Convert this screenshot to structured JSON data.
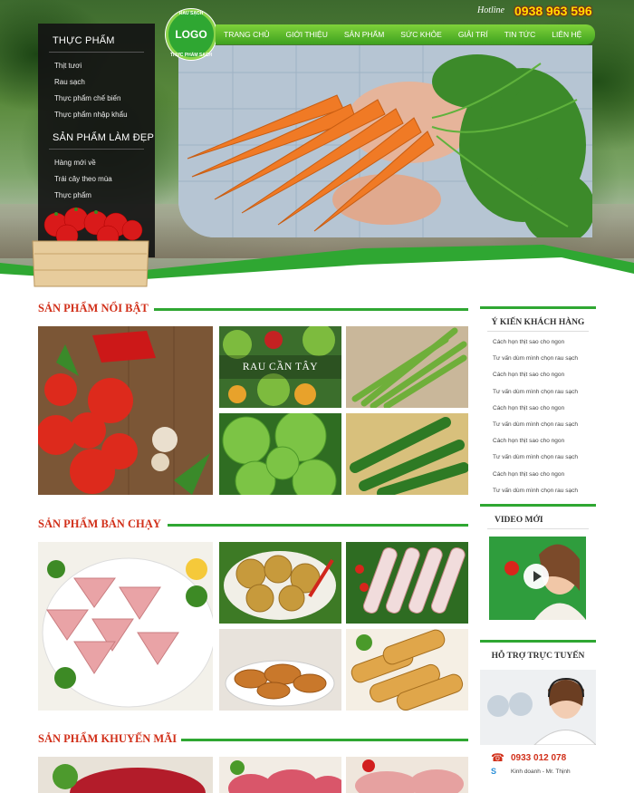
{
  "header": {
    "hotline_label": "Hotline",
    "hotline_number": "0938 963 596",
    "logo_text": "LOGO",
    "logo_ring_top": "RAU SẠCH",
    "logo_ring_bottom": "THỰC PHẨM SẠCH",
    "nav": [
      "TRANG CHỦ",
      "GIỚI THIỆU",
      "SẢN PHẨM",
      "SỨC KHỎE",
      "GIẢI TRÍ",
      "TIN TỨC",
      "LIÊN HỆ"
    ]
  },
  "left_menu": {
    "group1_title": "THỰC PHẨM",
    "group1_items": [
      "Thịt tươi",
      "Rau sạch",
      "Thực phẩm chế biến",
      "Thực phẩm nhập khẩu"
    ],
    "group2_title": "SẢN PHẨM LÀM ĐẸP",
    "group2_items": [
      "Hàng mới về",
      "Trái cây theo mùa",
      "Thực phẩm"
    ]
  },
  "sections": {
    "featured_title": "SẢN PHẨM NỔI BẬT",
    "featured_overlay": "RAU CẦN TÂY",
    "bestseller_title": "SẢN PHẨM BÁN CHẠY",
    "promo_title": "SẢN PHẨM KHUYẾN MÃI"
  },
  "sidebar": {
    "reviews_title": "Ý KIẾN KHÁCH HÀNG",
    "reviews": [
      "Cách họn thịt sao cho ngon",
      "Tư vấn dùm mình chọn rau sạch",
      "Cách họn thịt sao cho ngon",
      "Tư vấn dùm mình chọn rau sạch",
      "Cách họn thịt sao cho ngon",
      "Tư vấn dùm mình chọn rau sạch",
      "Cách họn thịt sao cho ngon",
      "Tư vấn dùm mình chọn rau sạch",
      "Cách họn thịt sao cho ngon",
      "Tư vấn dùm mình chọn rau sạch"
    ],
    "video_title": "VIDEO MỚI",
    "support_title": "HỖ TRỢ TRỰC TUYẾN",
    "support_phone": "0933 012 078",
    "support_name": "Kinh doanh - Mr. Thịnh"
  },
  "colors": {
    "green": "#2fa732",
    "red_title": "#d12f19",
    "hotline_yellow": "#ffe100"
  }
}
